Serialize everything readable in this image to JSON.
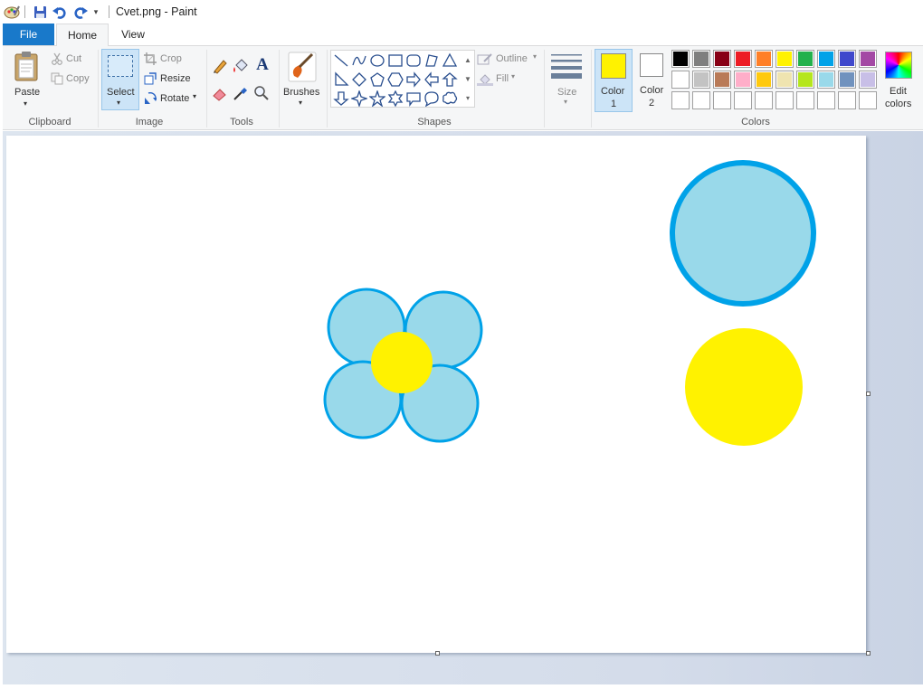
{
  "window": {
    "title": "Cvet.png - Paint"
  },
  "tabs": {
    "file": "File",
    "home": "Home",
    "view": "View"
  },
  "ribbon": {
    "clipboard": {
      "paste": "Paste",
      "cut": "Cut",
      "copy": "Copy",
      "group": "Clipboard"
    },
    "image": {
      "select": "Select",
      "crop": "Crop",
      "resize": "Resize",
      "rotate": "Rotate",
      "group": "Image"
    },
    "tools": {
      "group": "Tools"
    },
    "brushes": {
      "label": "Brushes"
    },
    "shapes": {
      "outline": "Outline",
      "fill": "Fill",
      "group": "Shapes"
    },
    "size": {
      "label": "Size"
    },
    "colors": {
      "color1": "Color",
      "color1_num": "1",
      "color2": "Color",
      "color2_num": "2",
      "edit": "Edit",
      "edit2": "colors",
      "group": "Colors",
      "color1_value": "#fff200",
      "color2_value": "#ffffff",
      "palette_row1": [
        "#000000",
        "#7f7f7f",
        "#880015",
        "#ed1c24",
        "#ff7f27",
        "#fff200",
        "#22b14c",
        "#00a2e8",
        "#3f48cc",
        "#a349a4"
      ],
      "palette_row2": [
        "#ffffff",
        "#c3c3c3",
        "#b97a57",
        "#ffaec9",
        "#ffc90e",
        "#efe4b0",
        "#b5e61d",
        "#99d9ea",
        "#7092be",
        "#c8bfe7"
      ],
      "palette_row3": [
        "#ffffff",
        "#ffffff",
        "#ffffff",
        "#ffffff",
        "#ffffff",
        "#ffffff",
        "#ffffff",
        "#ffffff",
        "#ffffff",
        "#ffffff"
      ]
    }
  },
  "canvas": {
    "fill_colors": {
      "petal": "#99d9ea",
      "outline": "#00a2e8",
      "center": "#fff200"
    }
  }
}
